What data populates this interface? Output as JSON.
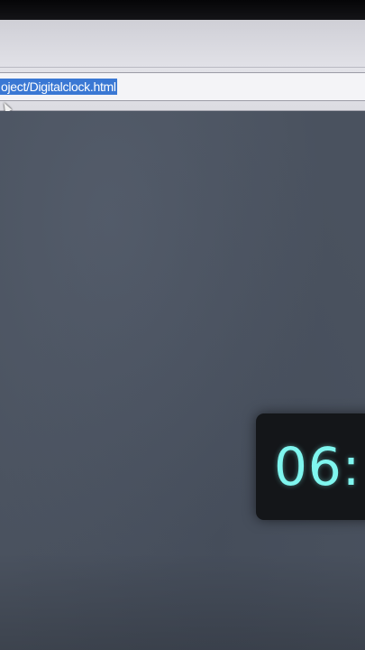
{
  "browser": {
    "address_bar": {
      "url": "oject/Digitalclock.html",
      "selected": true
    }
  },
  "page": {
    "clock": {
      "time_visible": "06:"
    }
  },
  "colors": {
    "page_background": "#4a525f",
    "clock_background": "#141619",
    "clock_digits": "#7ff6ef",
    "selection_highlight": "#3a78d4"
  }
}
